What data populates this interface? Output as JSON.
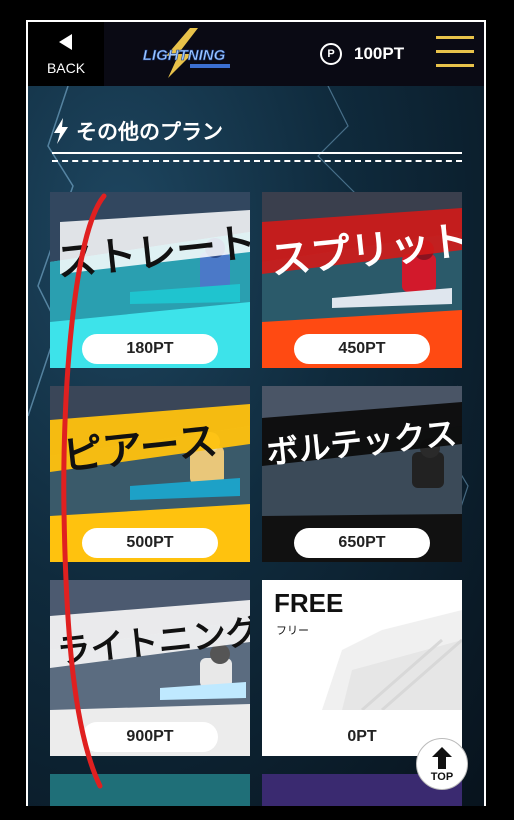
{
  "header": {
    "back_label": "BACK",
    "logo_text": "LIGHTNING",
    "points_icon": "P",
    "points": "100PT"
  },
  "section": {
    "title": "その他のプラン"
  },
  "plans": [
    {
      "title": "ストレート",
      "price": "180PT"
    },
    {
      "title": "スプリット",
      "price": "450PT"
    },
    {
      "title": "ピアース",
      "price": "500PT"
    },
    {
      "title": "ボルテックス",
      "price": "650PT"
    },
    {
      "title": "ライトニング",
      "price": "900PT"
    },
    {
      "title": "FREE",
      "subtitle": "フリー",
      "price": "0PT"
    }
  ],
  "top_button": {
    "label": "TOP"
  },
  "colors": {
    "accent": "#e8c24a",
    "annotation": "#e02020"
  }
}
